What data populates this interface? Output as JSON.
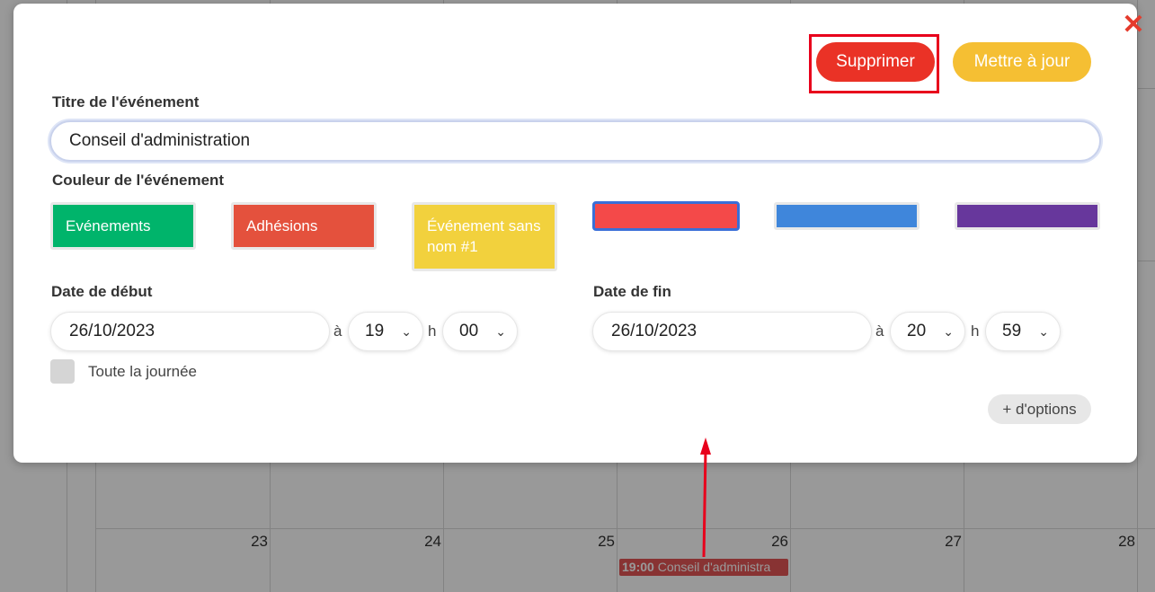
{
  "calendar": {
    "days": [
      "23",
      "24",
      "25",
      "26",
      "27",
      "28"
    ],
    "event": {
      "time": "19:00",
      "title": "Conseil d'administra"
    }
  },
  "modal": {
    "close_icon": "close-x-icon",
    "delete_label": "Supprimer",
    "update_label": "Mettre à jour",
    "title_label": "Titre de l'événement",
    "title_value": "Conseil d'administration",
    "color_label": "Couleur de l'événement",
    "swatches": [
      {
        "label": "Evénements",
        "color": "#00b46b"
      },
      {
        "label": "Adhésions",
        "color": "#e4513d"
      },
      {
        "label": "Événement sans nom #1",
        "color": "#f2d13d"
      },
      {
        "label": "",
        "color": "#f44949",
        "selected": true
      },
      {
        "label": "",
        "color": "#3f86db"
      },
      {
        "label": "",
        "color": "#67379c"
      }
    ],
    "start": {
      "label": "Date de début",
      "date": "26/10/2023",
      "at": "à",
      "hour": "19",
      "h": "h",
      "minute": "00"
    },
    "end": {
      "label": "Date de fin",
      "date": "26/10/2023",
      "at": "à",
      "hour": "20",
      "h": "h",
      "minute": "59"
    },
    "all_day_label": "Toute la journée",
    "more_options_label": "+ d'options"
  },
  "colors": {
    "delete": "#ea3226",
    "update": "#f5bf33",
    "annotation": "#e8001c"
  }
}
